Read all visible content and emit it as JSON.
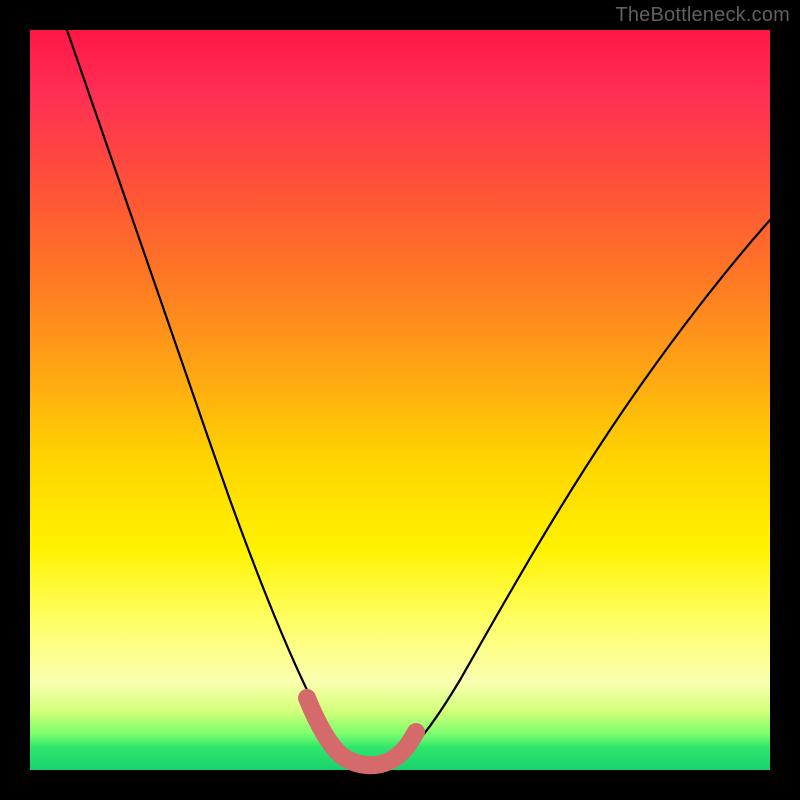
{
  "watermark": "TheBottleneck.com",
  "colors": {
    "background": "#000000",
    "gradient_top": "#ff1744",
    "gradient_mid": "#ffd400",
    "gradient_bottom": "#18d26e",
    "curve_stroke": "#000000",
    "highlight_stroke": "#d46a6a"
  },
  "chart_data": {
    "type": "line",
    "title": "",
    "xlabel": "",
    "ylabel": "",
    "xlim": [
      0,
      100
    ],
    "ylim": [
      0,
      100
    ],
    "grid": false,
    "legend": false,
    "series": [
      {
        "name": "bottleneck-curve",
        "x": [
          5,
          10,
          15,
          20,
          25,
          30,
          35,
          38,
          40,
          42,
          45,
          48,
          50,
          55,
          60,
          65,
          70,
          75,
          80,
          85,
          90,
          95,
          100
        ],
        "values": [
          100,
          88,
          76,
          64,
          52,
          40,
          26,
          14,
          6,
          2,
          1,
          1,
          2,
          8,
          16,
          24,
          32,
          39,
          46,
          52,
          57,
          62,
          66
        ]
      }
    ],
    "highlight_segment": {
      "x": [
        37,
        38,
        40,
        42,
        45,
        48,
        50,
        51
      ],
      "values": [
        17,
        14,
        6,
        2,
        1,
        1,
        2,
        4
      ]
    },
    "annotations": []
  }
}
